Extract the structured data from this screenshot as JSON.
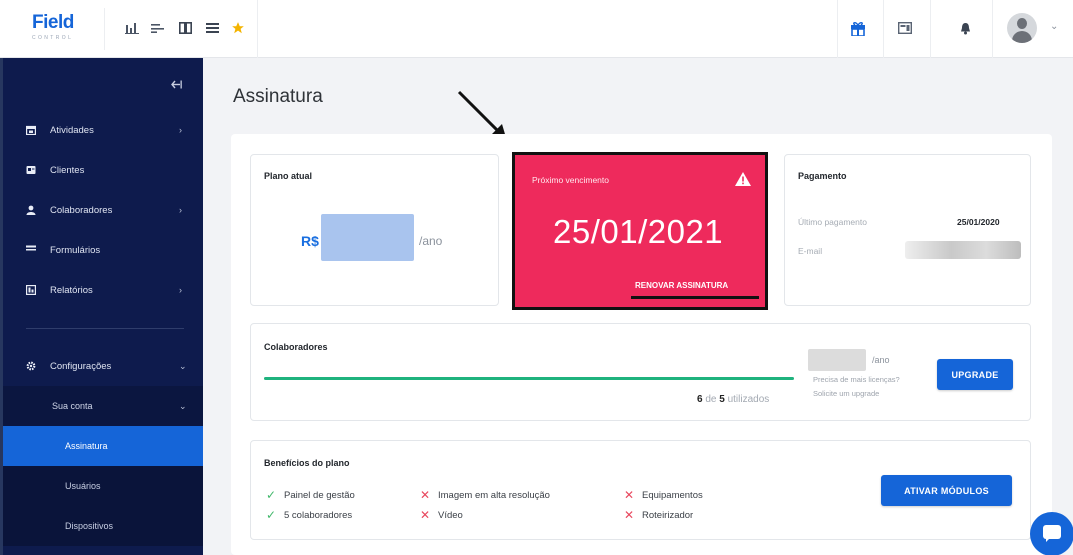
{
  "brand": {
    "logo_text": "Field",
    "logo_sub": "CONTROL"
  },
  "topbar": {
    "icons": [
      "bar-chart-icon",
      "list-icon",
      "columns-icon",
      "menu-icon",
      "star-icon"
    ],
    "right_icons": [
      "gift-icon",
      "calendar-icon",
      "bell-icon"
    ],
    "avatar_caret": "⌄"
  },
  "sidebar": {
    "items": [
      {
        "label": "Atividades",
        "icon": "calendar-icon",
        "has_caret": true
      },
      {
        "label": "Clientes",
        "icon": "id-card-icon",
        "has_caret": false
      },
      {
        "label": "Colaboradores",
        "icon": "user-icon",
        "has_caret": true
      },
      {
        "label": "Formulários",
        "icon": "form-icon",
        "has_caret": false
      },
      {
        "label": "Relatórios",
        "icon": "report-icon",
        "has_caret": true
      }
    ],
    "settings": {
      "label": "Configurações",
      "icon": "gear-icon"
    },
    "account": {
      "label": "Sua conta"
    },
    "account_items": [
      {
        "label": "Assinatura",
        "active": true
      },
      {
        "label": "Usuários",
        "active": false
      },
      {
        "label": "Dispositivos",
        "active": false
      }
    ]
  },
  "page": {
    "title": "Assinatura"
  },
  "plano": {
    "title": "Plano atual",
    "currency": "R$",
    "period": "/ano"
  },
  "vencimento": {
    "title": "Próximo vencimento",
    "date": "25/01/2021",
    "action": "RENOVAR ASSINATURA",
    "bg_color": "#ee2a5c"
  },
  "pagamento": {
    "title": "Pagamento",
    "last_label": "Último pagamento",
    "last_value": "25/01/2020",
    "email_label": "E-mail"
  },
  "colaboradores": {
    "title": "Colaboradores",
    "used": "6",
    "of": "de",
    "total": "5",
    "used_label": "utilizados",
    "progress_fraction": 1.0,
    "period": "/ano",
    "hint_1": "Precisa de mais licenças?",
    "hint_2": "Solicite um upgrade",
    "upgrade_label": "UPGRADE"
  },
  "beneficios": {
    "title": "Benefícios do plano",
    "included": [
      "Painel de gestão",
      "5 colaboradores"
    ],
    "excluded_col1": [
      "Imagem em alta resolução",
      "Vídeo"
    ],
    "excluded_col2": [
      "Equipamentos",
      "Roteirizador"
    ],
    "action_label": "ATIVAR MÓDULOS"
  },
  "colors": {
    "primary": "#1565d8",
    "sidebar": "#0e1b4d",
    "success": "#1fb37e",
    "danger": "#e8485e"
  }
}
